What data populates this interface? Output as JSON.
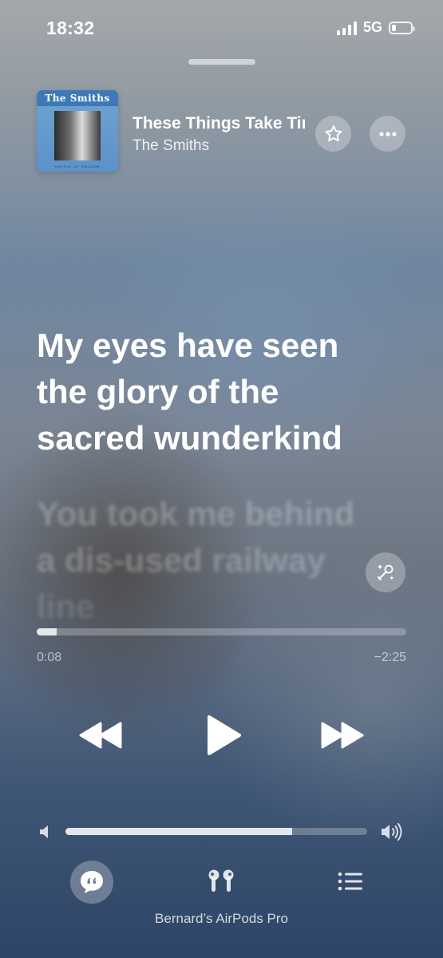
{
  "status_bar": {
    "time": "18:32",
    "network": "5G"
  },
  "now_playing": {
    "album_title": "The Smiths",
    "album_subtitle": "HATFUL OF HOLLOW",
    "track_title": "These Things Take Time",
    "artist": "The Smiths"
  },
  "lyrics": {
    "active": [
      "My eyes have seen",
      "the glory of the",
      "sacred wunderkind"
    ],
    "upcoming": [
      "You took me behind",
      "a dis-used railway",
      "line"
    ]
  },
  "playback": {
    "elapsed": "0:08",
    "remaining": "−2:25",
    "progress_fraction": 0.055
  },
  "volume": {
    "level_fraction": 0.75
  },
  "output_device": "Bernard’s AirPods Pro",
  "icons": {
    "favorite": "star-icon",
    "more": "ellipsis-icon",
    "sing": "microphone-sparkle-icon",
    "rewind": "backward-icon",
    "play": "play-icon",
    "forward": "forward-icon",
    "volume_low": "speaker-low-icon",
    "volume_high": "speaker-high-icon",
    "lyrics": "quote-bubble-icon",
    "airplay": "airpods-icon",
    "queue": "list-icon"
  }
}
